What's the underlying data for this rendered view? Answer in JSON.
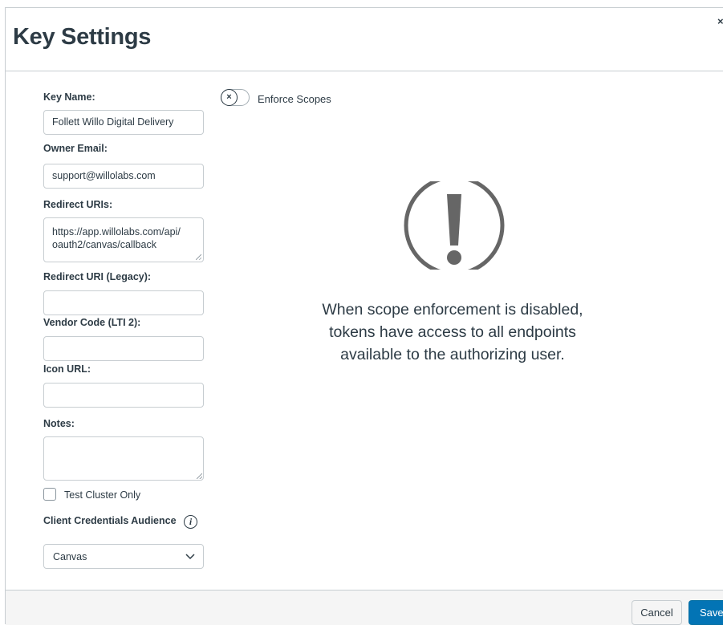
{
  "header": {
    "title": "Key Settings",
    "close_label": "×"
  },
  "form": {
    "key_name": {
      "label": "Key Name:",
      "value": "Follett Willo Digital Delivery"
    },
    "owner_email": {
      "label": "Owner Email:",
      "value": "support@willolabs.com"
    },
    "redirect_uris": {
      "label": "Redirect URIs:",
      "line1": "https://app.willolabs.com/api/",
      "line2": "oauth2/canvas/callback"
    },
    "redirect_uri_legacy": {
      "label": "Redirect URI (Legacy):",
      "value": ""
    },
    "vendor_code": {
      "label": "Vendor Code (LTI 2):",
      "value": ""
    },
    "icon_url": {
      "label": "Icon URL:",
      "value": ""
    },
    "notes": {
      "label": "Notes:",
      "value": ""
    },
    "test_cluster": {
      "label": "Test Cluster Only",
      "checked": false
    },
    "client_credentials_audience": {
      "label": "Client Credentials Audience",
      "selected": "Canvas"
    }
  },
  "scopes": {
    "toggle_label": "Enforce Scopes",
    "toggle_symbol": "×",
    "enabled": false,
    "warning_line1": "When scope enforcement is disabled,",
    "warning_line2": "tokens have access to all endpoints",
    "warning_line3": "available to the authorizing user."
  },
  "footer": {
    "cancel_label": "Cancel",
    "save_label": "Save"
  },
  "colors": {
    "primary": "#0374b5",
    "text": "#2d3b45",
    "border": "#c7cdd1",
    "icon": "#666666"
  }
}
